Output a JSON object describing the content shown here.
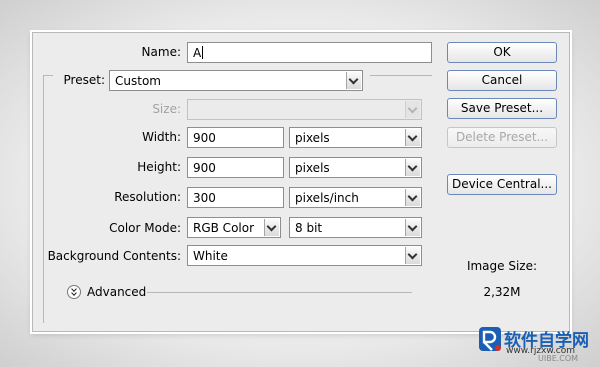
{
  "name": {
    "label": "Name:",
    "value": "A"
  },
  "preset": {
    "label": "Preset:",
    "value": "Custom"
  },
  "size": {
    "label": "Size:",
    "value": ""
  },
  "width": {
    "label": "Width:",
    "value": "900",
    "unit": "pixels"
  },
  "height": {
    "label": "Height:",
    "value": "900",
    "unit": "pixels"
  },
  "resolution": {
    "label": "Resolution:",
    "value": "300",
    "unit": "pixels/inch"
  },
  "color_mode": {
    "label": "Color Mode:",
    "value": "RGB Color",
    "depth": "8 bit"
  },
  "background": {
    "label": "Background Contents:",
    "value": "White"
  },
  "advanced": {
    "label": "Advanced"
  },
  "buttons": {
    "ok": "OK",
    "cancel": "Cancel",
    "save_preset": "Save Preset...",
    "delete_preset": "Delete Preset...",
    "device_central": "Device Central..."
  },
  "image_size": {
    "label": "Image Size:",
    "value": "2,32M"
  },
  "watermark": {
    "text": "软件自学网",
    "url": "www.rjzxw.com",
    "site": "UIBE.COM"
  },
  "colors": {
    "button_border": "#6c88b8",
    "dialog_bg": "#ececec",
    "logo_blue": "#1a5fb4",
    "logo_red": "#d0322a"
  }
}
